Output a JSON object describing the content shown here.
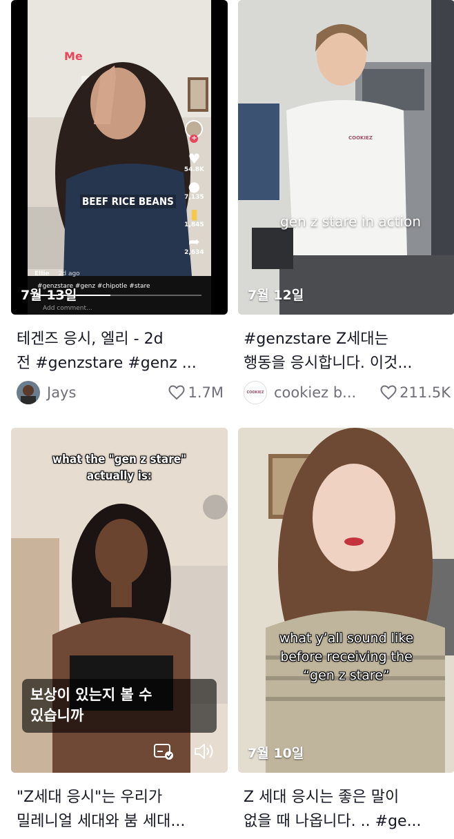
{
  "cards": [
    {
      "date": "7월 13일",
      "title_line1": "테겐즈 응시, 엘리 - 2d",
      "title_line2": "전 #genzstare #genz ...",
      "author": "Jays",
      "likes": "1.7M",
      "overlay": {
        "me_label": "Me",
        "caption": "BEEF RICE BEANS",
        "stats": [
          "54.8K",
          "7,135",
          "1,845",
          "2,634"
        ],
        "username": "Ellie",
        "ago": "2d ago",
        "hashtags": "#genzstare #genz #chipotle #stare",
        "comment_placeholder": "Add comment..."
      }
    },
    {
      "date": "7월 12일",
      "title_line1": "#genzstare Z세대는",
      "title_line2": "행동을 응시합니다. 이것...",
      "author": "cookiez b...",
      "likes": "211.5K",
      "overlay": {
        "caption": "gen z stare in action",
        "shirt_logo": "COOKIEZ",
        "avatar_logo": "COOKIEZ"
      }
    },
    {
      "date": "",
      "title_line1": "\"Z세대 응시\"는 우리가",
      "title_line2": "밀레니얼 세대와 붐 세대...",
      "overlay": {
        "caption_line1": "what the \"gen z stare\"",
        "caption_line2": "actually is:",
        "subtitle_line1": "보상이 있는지 볼 수",
        "subtitle_line2": "있습니까"
      }
    },
    {
      "date": "7월 10일",
      "title_line1": "Z 세대 응시는 좋은 말이",
      "title_line2": "없을 때 나옵니다. .. #ge...",
      "overlay": {
        "caption_line1": "what y’all sound like",
        "caption_line2": "before receiving the",
        "caption_line3": "“gen z stare”"
      }
    }
  ],
  "colors": {
    "text": "#161823",
    "muted": "#6f6f78",
    "highlight": "#e8445a"
  },
  "icons": [
    "heart-icon",
    "comment-icon",
    "bookmark-icon",
    "share-icon",
    "captions-icon",
    "volume-icon"
  ]
}
